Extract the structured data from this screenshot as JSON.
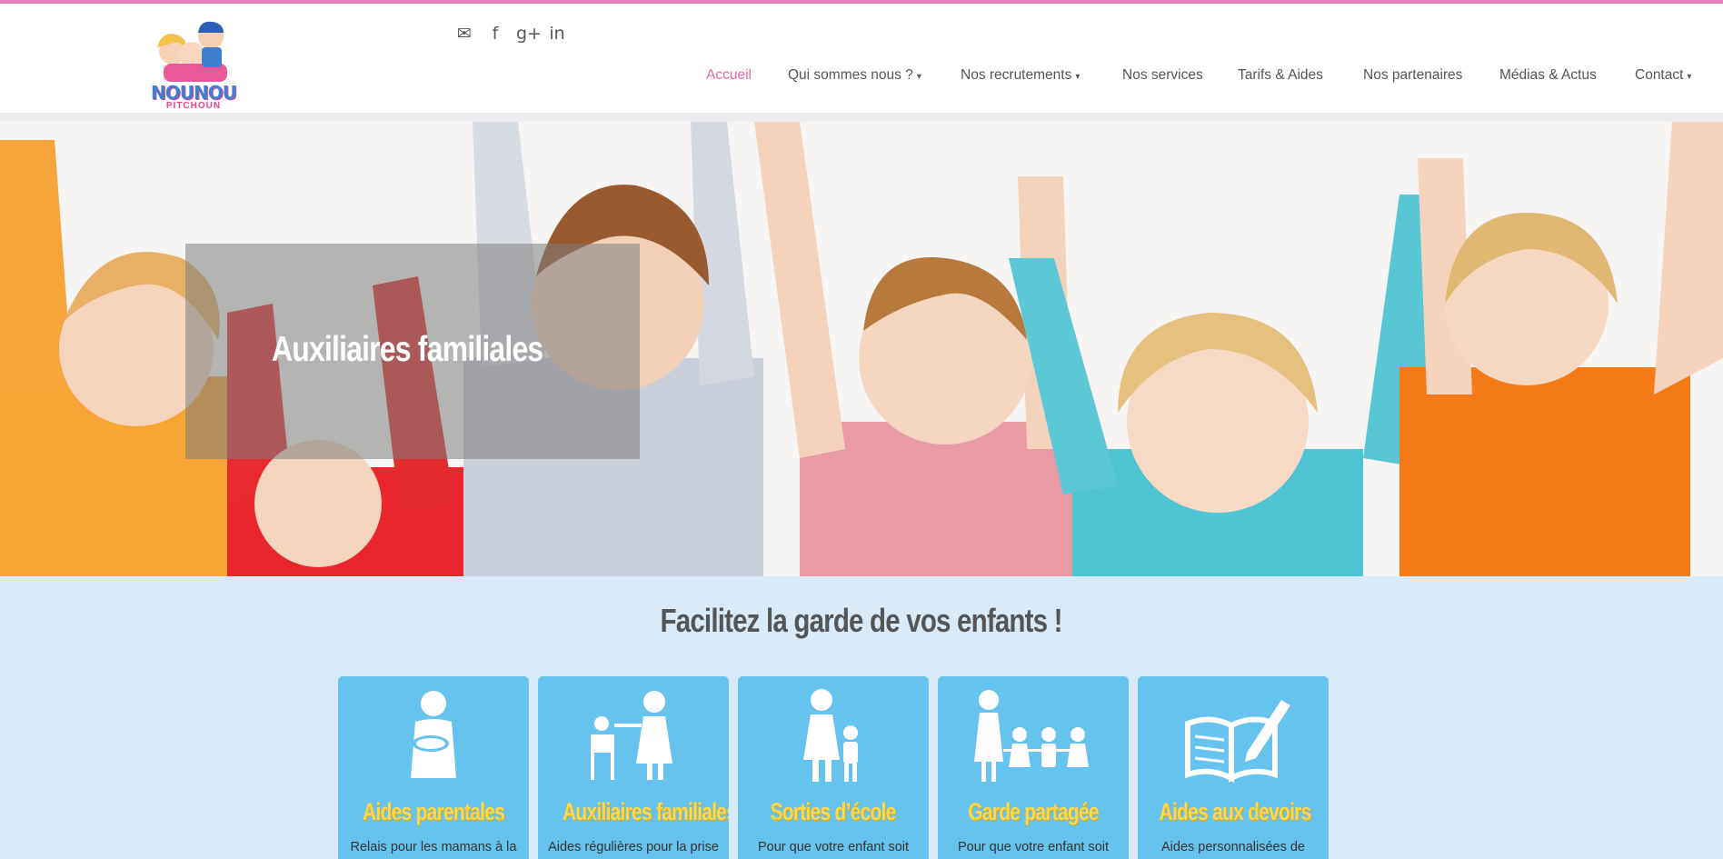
{
  "brand": {
    "name": "NOUNOU",
    "tagline": "PITCHOUN"
  },
  "social": [
    {
      "icon": "envelope-icon",
      "glyph": "✉"
    },
    {
      "icon": "facebook-icon",
      "glyph": "f"
    },
    {
      "icon": "google-plus-icon",
      "glyph": "g+"
    },
    {
      "icon": "linkedin-icon",
      "glyph": "in"
    }
  ],
  "nav": {
    "items": [
      {
        "label": "Accueil",
        "active": true,
        "dropdown": false
      },
      {
        "label": "Qui sommes nous ?",
        "active": false,
        "dropdown": true
      },
      {
        "label": "Nos recrutements",
        "active": false,
        "dropdown": true
      },
      {
        "label": "Nos services",
        "active": false,
        "dropdown": false
      },
      {
        "label": "Tarifs & Aides",
        "active": false,
        "dropdown": false
      },
      {
        "label": "Nos partenaires",
        "active": false,
        "dropdown": false
      },
      {
        "label": "Médias & Actus",
        "active": false,
        "dropdown": false
      },
      {
        "label": "Contact",
        "active": false,
        "dropdown": true
      }
    ],
    "caret": "▾"
  },
  "hero": {
    "title": "Auxiliaires familiales"
  },
  "services": {
    "heading": "Facilitez la garde de vos enfants !",
    "cards": [
      {
        "title": "Aides parentales",
        "desc": "Relais pour les mamans à la",
        "icon": "mother-baby-icon"
      },
      {
        "title": "Auxiliaires familiales",
        "desc": "Aides régulières pour la prise",
        "icon": "feeding-child-icon"
      },
      {
        "title": "Sorties d’école",
        "desc": "Pour que votre enfant soit",
        "icon": "adult-with-child-icon"
      },
      {
        "title": "Garde partagée",
        "desc": "Pour que votre enfant soit",
        "icon": "group-of-children-icon"
      },
      {
        "title": "Aides aux devoirs",
        "desc": "Aides personnalisées de",
        "icon": "book-pencil-icon"
      }
    ]
  },
  "colors": {
    "accent": "#e26aa9",
    "topline": "#e77fc0",
    "card": "#66c3ee",
    "card_title": "#ffd84a",
    "section_bg": "#d9ebf9"
  }
}
